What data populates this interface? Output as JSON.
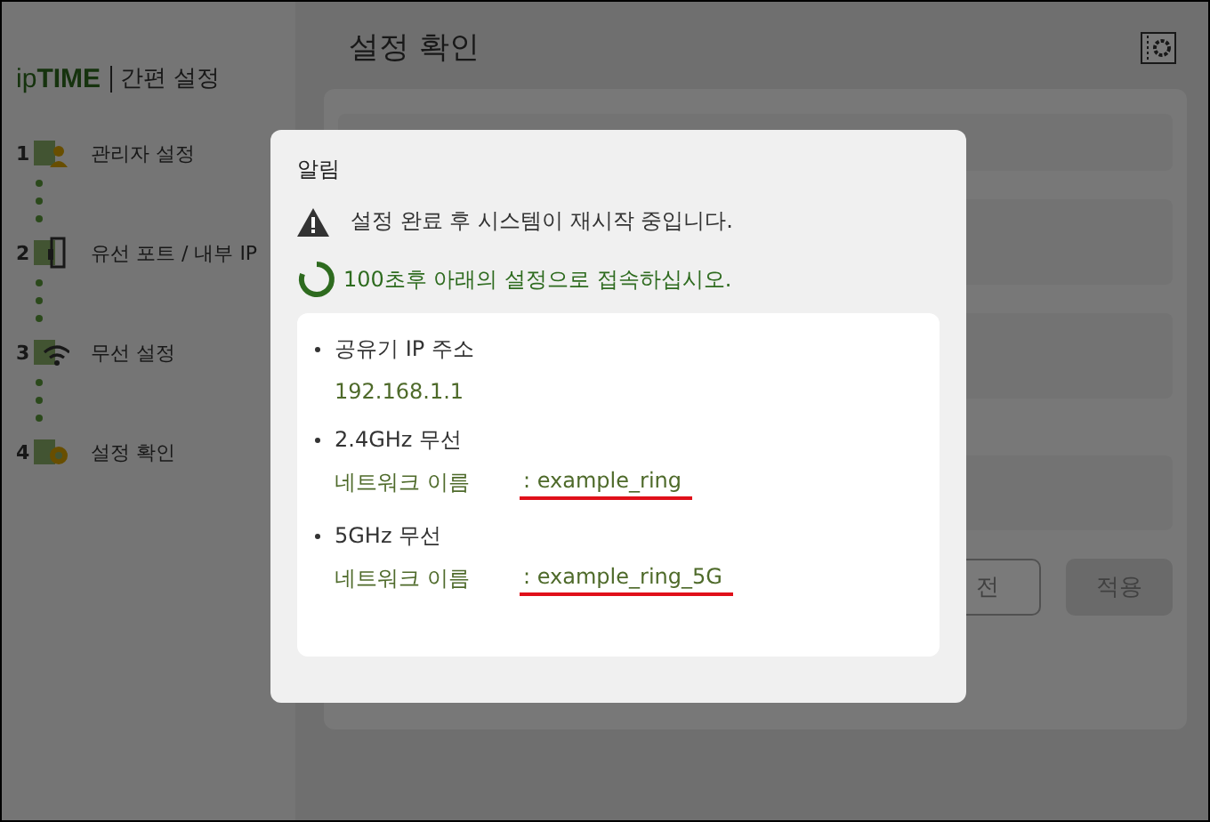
{
  "sidebar": {
    "logo": "ip**TIME**",
    "title": "간편 설정",
    "steps": [
      {
        "number": "1",
        "label": "관리자 설정",
        "kind": "admin"
      },
      {
        "number": "2",
        "label": "유선 포트 / 내부 IP",
        "kind": "port"
      },
      {
        "number": "3",
        "label": "무선 설정",
        "kind": "wireless"
      },
      {
        "number": "4",
        "label": "설정 확인",
        "kind": "confirm"
      }
    ]
  },
  "main": {
    "title": "설정 확인",
    "buttons": [
      {
        "label": "전",
        "kind": "outline"
      },
      {
        "label": "적용",
        "kind": "filled"
      }
    ]
  },
  "dialog": {
    "title": "알림",
    "warning": "설정 완료 후 시스템이 재시작 중입니다.",
    "countdown": "100초후 아래의 설정으로 접속하십시오.",
    "sections": [
      {
        "heading": "공유기 IP 주소",
        "kind": "plain",
        "value": "192.168.1.1"
      },
      {
        "heading": "2.4GHz 무선",
        "kind": "field",
        "label": "네트워크 이름",
        "value": ": example_ring",
        "underlined": true
      },
      {
        "heading": "5GHz 무선",
        "kind": "field",
        "label": "네트워크 이름",
        "value": ": example_ring_5G",
        "underlined": true
      }
    ]
  }
}
